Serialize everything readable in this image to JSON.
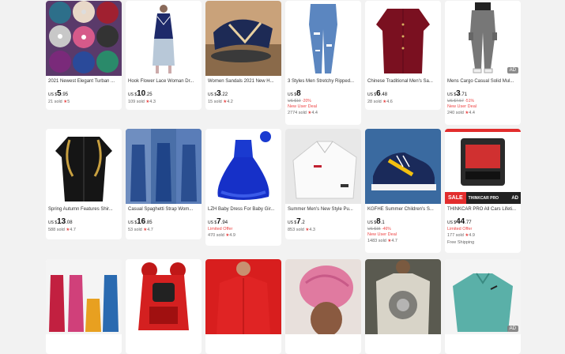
{
  "currency": "US $",
  "products": [
    {
      "title": "2021 Newest Elegant Turban ...",
      "price_int": "5",
      "price_dec": ".95",
      "sold": "21 sold",
      "rating": "5"
    },
    {
      "title": "Hook Flower Lace Woman Dr...",
      "price_int": "10",
      "price_dec": ".25",
      "sold": "109 sold",
      "rating": "4.3"
    },
    {
      "title": "Women Sandals 2021 New H...",
      "price_int": "3",
      "price_dec": ".22",
      "sold": "15 sold",
      "rating": "4.2"
    },
    {
      "title": "3 Styles Men Stretchy Ripped...",
      "price_int": "8",
      "price_dec": "",
      "orig": "US $10",
      "discount": "-20%",
      "tag": "New User Deal",
      "sold": "2774 sold",
      "rating": "4.4"
    },
    {
      "title": "Chinese Traditional Men's Sa...",
      "price_int": "6",
      "price_dec": ".48",
      "sold": "28 sold",
      "rating": "4.6"
    },
    {
      "title": "Mens Cargo Casual Solid Mul...",
      "price_int": "3",
      "price_dec": ".71",
      "orig": "US $7.57",
      "discount": "-51%",
      "tag": "New User Deal",
      "sold": "240 sold",
      "rating": "4.4",
      "ad": "AD"
    },
    {
      "title": "Spring Autumn Features Shir...",
      "price_int": "13",
      "price_dec": ".08",
      "sold": "588 sold",
      "rating": "4.7"
    },
    {
      "title": "Casual Spaghetti Strap Wom...",
      "price_int": "16",
      "price_dec": ".85",
      "sold": "53 sold",
      "rating": "4.7"
    },
    {
      "title": "LZH Baby Dress For Baby Gir...",
      "price_int": "7",
      "price_dec": ".94",
      "tag": "Limited Offer",
      "sold": "470 sold",
      "rating": "4.9"
    },
    {
      "title": "Summer Men's New Style Pu...",
      "price_int": "7",
      "price_dec": ".2",
      "sold": "853 sold",
      "rating": "4.3"
    },
    {
      "title": "KGFHE Summer Children's S...",
      "price_int": "8",
      "price_dec": ".1",
      "orig": "US $15",
      "discount": "-46%",
      "tag": "New User Deal",
      "sold": "1483 sold",
      "rating": "4.7"
    },
    {
      "title": "THINKCAR PRO All Cars Lifeti...",
      "price_int": "44",
      "price_dec": ".77",
      "tag": "Limited Offer",
      "sold": "177 sold",
      "rating": "4.9",
      "shipping": "Free Shipping",
      "ad": "AD",
      "banner_sale": "SALE",
      "banner_text": "THINKCAR PRO"
    },
    {
      "title": "",
      "price_int": "",
      "price_dec": "",
      "sold": "",
      "rating": ""
    },
    {
      "title": "",
      "price_int": "",
      "price_dec": "",
      "sold": "",
      "rating": ""
    },
    {
      "title": "",
      "price_int": "",
      "price_dec": "",
      "sold": "",
      "rating": ""
    },
    {
      "title": "",
      "price_int": "",
      "price_dec": "",
      "sold": "",
      "rating": ""
    },
    {
      "title": "",
      "price_int": "",
      "price_dec": "",
      "sold": "",
      "rating": ""
    },
    {
      "title": "",
      "price_int": "",
      "price_dec": "",
      "sold": "",
      "rating": "",
      "ad": "AD"
    }
  ],
  "star_glyph": "★"
}
